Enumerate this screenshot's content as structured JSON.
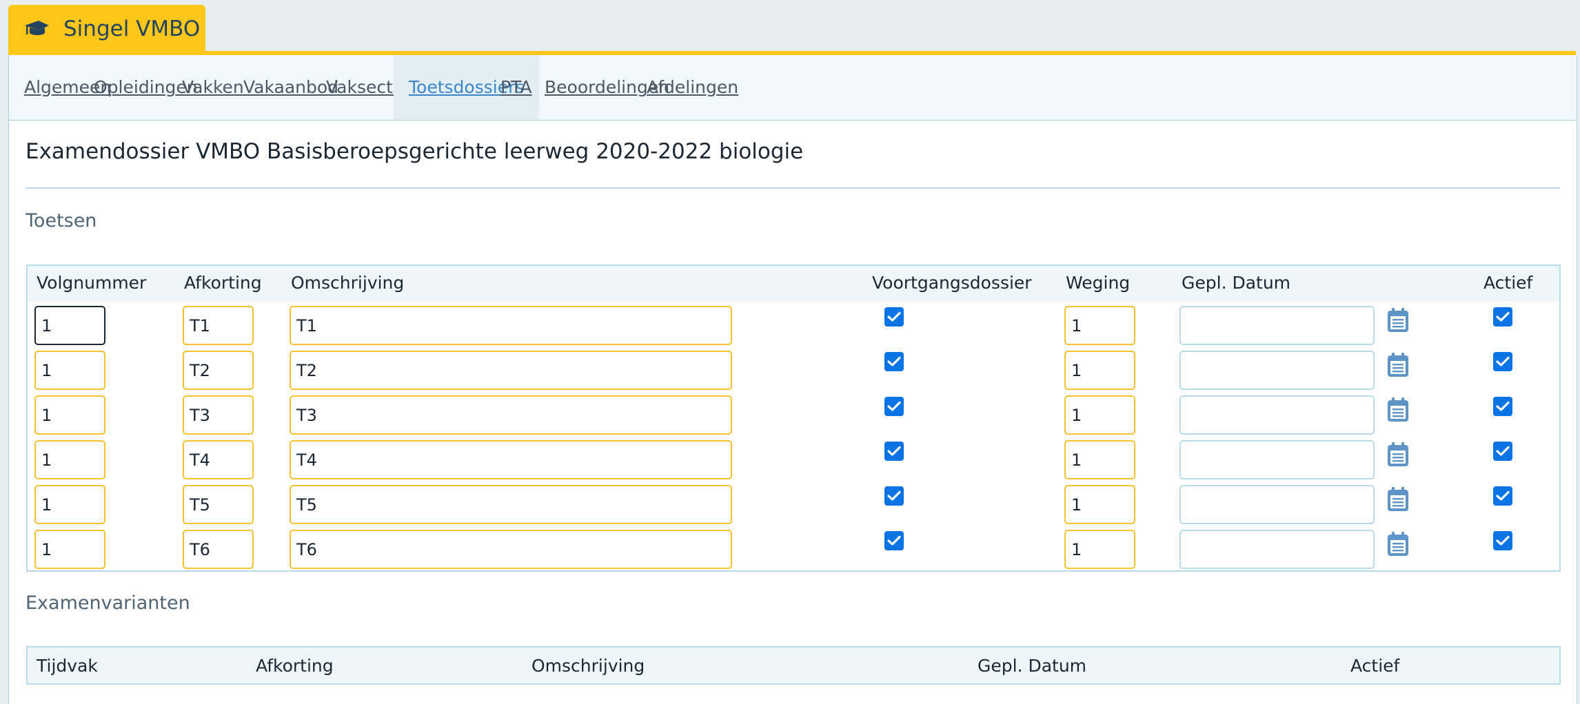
{
  "app": {
    "title": "Singel VMBO",
    "icon": "graduation-cap-icon",
    "accent": "#ffc61a"
  },
  "tabs": [
    {
      "label": "Algemeen"
    },
    {
      "label": "Opleidingen"
    },
    {
      "label": "Vakken"
    },
    {
      "label": "Vakaanbod"
    },
    {
      "label": "Vaksecties"
    },
    {
      "label": "Toetsdossiers",
      "active": true
    },
    {
      "label": "PTA"
    },
    {
      "label": "Beoordelingen"
    },
    {
      "label": "Afdelingen"
    }
  ],
  "page_title": "Examendossier VMBO Basisberoepsgerichte leerweg 2020-2022 biologie",
  "toetsen": {
    "section_title": "Toetsen",
    "columns": [
      "Volgnummer",
      "Afkorting",
      "Omschrijving",
      "Voortgangsdossier",
      "Weging",
      "Gepl. Datum",
      "Actief"
    ],
    "rows": [
      {
        "volgnummer": "1",
        "afkorting": "T1",
        "omschrijving": "T1",
        "voortgangsdossier": true,
        "weging": "1",
        "datum": "",
        "actief": true
      },
      {
        "volgnummer": "1",
        "afkorting": "T2",
        "omschrijving": "T2",
        "voortgangsdossier": true,
        "weging": "1",
        "datum": "",
        "actief": true
      },
      {
        "volgnummer": "1",
        "afkorting": "T3",
        "omschrijving": "T3",
        "voortgangsdossier": true,
        "weging": "1",
        "datum": "",
        "actief": true
      },
      {
        "volgnummer": "1",
        "afkorting": "T4",
        "omschrijving": "T4",
        "voortgangsdossier": true,
        "weging": "1",
        "datum": "",
        "actief": true
      },
      {
        "volgnummer": "1",
        "afkorting": "T5",
        "omschrijving": "T5",
        "voortgangsdossier": true,
        "weging": "1",
        "datum": "",
        "actief": true
      },
      {
        "volgnummer": "1",
        "afkorting": "T6",
        "omschrijving": "T6",
        "voortgangsdossier": true,
        "weging": "1",
        "datum": "",
        "actief": true
      }
    ]
  },
  "examenvarianten": {
    "section_title": "Examenvarianten",
    "columns": [
      "Tijdvak",
      "Afkorting",
      "Omschrijving",
      "Gepl. Datum",
      "Actief"
    ]
  }
}
